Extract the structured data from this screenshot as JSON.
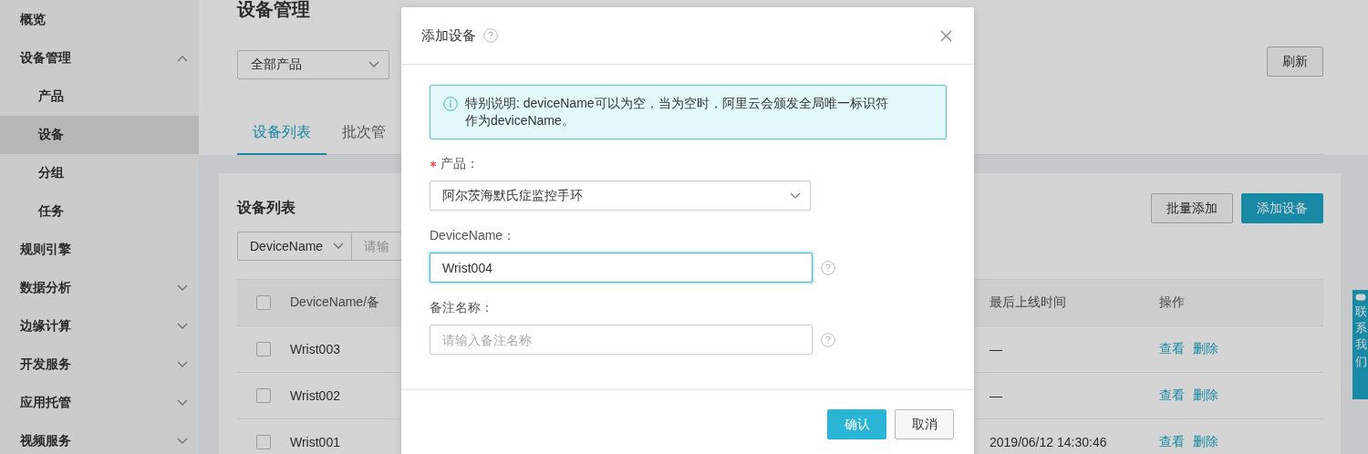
{
  "sidebar": {
    "items": [
      {
        "label": "概览",
        "kind": "link",
        "selected": false
      },
      {
        "label": "设备管理",
        "kind": "group",
        "expanded": true,
        "children": [
          {
            "label": "产品",
            "selected": false
          },
          {
            "label": "设备",
            "selected": true
          },
          {
            "label": "分组",
            "selected": false
          },
          {
            "label": "任务",
            "selected": false
          }
        ]
      },
      {
        "label": "规则引擎",
        "kind": "link",
        "selected": false
      },
      {
        "label": "数据分析",
        "kind": "group",
        "expanded": false
      },
      {
        "label": "边缘计算",
        "kind": "group",
        "expanded": false
      },
      {
        "label": "开发服务",
        "kind": "group",
        "expanded": false
      },
      {
        "label": "应用托管",
        "kind": "group",
        "expanded": false
      },
      {
        "label": "视频服务",
        "kind": "group",
        "expanded": false
      }
    ]
  },
  "page": {
    "title": "设备管理",
    "product_filter": "全部产品",
    "refresh_button": "刷新",
    "tabs": [
      {
        "label": "设备列表",
        "selected": true
      },
      {
        "label": "批次管",
        "selected": false
      }
    ]
  },
  "card": {
    "title": "设备列表",
    "buttons": [
      {
        "label": "批量添加",
        "kind": "default"
      },
      {
        "label": "添加设备",
        "kind": "primary"
      }
    ],
    "search": {
      "field": "DeviceName",
      "placeholder": "请输"
    },
    "table": {
      "columns": {
        "column_1": "DeviceName/备",
        "last_online": "最后上线时间",
        "actions": "操作"
      },
      "header_checked": false,
      "rows": [
        {
          "name": "Wrist003",
          "checked": false,
          "last_online": "—",
          "actions": [
            "查看",
            "删除"
          ]
        },
        {
          "name": "Wrist002",
          "checked": false,
          "last_online": "—",
          "actions": [
            "查看",
            "删除"
          ]
        },
        {
          "name": "Wrist001",
          "checked": false,
          "last_online": "2019/06/12 14:30:46",
          "actions": [
            "查看",
            "删除"
          ]
        }
      ]
    }
  },
  "contact_widget": {
    "label": "联系我们"
  },
  "dialog": {
    "title": "添加设备",
    "notice": "特别说明: deviceName可以为空，当为空时，阿里云会颁发全局唯一标识符作为deviceName。",
    "fields": [
      {
        "label": "产品：",
        "kind": "select",
        "required": true,
        "value": "阿尔茨海默氏症监控手环",
        "help": false,
        "focused": false
      },
      {
        "label": "DeviceName：",
        "kind": "input",
        "required": false,
        "value": "Wrist004",
        "help": true,
        "focused": true
      },
      {
        "label": "备注名称：",
        "kind": "input",
        "required": false,
        "placeholder": "请输入备注名称",
        "help": true,
        "focused": false
      }
    ],
    "buttons": [
      {
        "label": "确认",
        "kind": "primary"
      },
      {
        "label": "取消",
        "kind": "default"
      }
    ]
  }
}
